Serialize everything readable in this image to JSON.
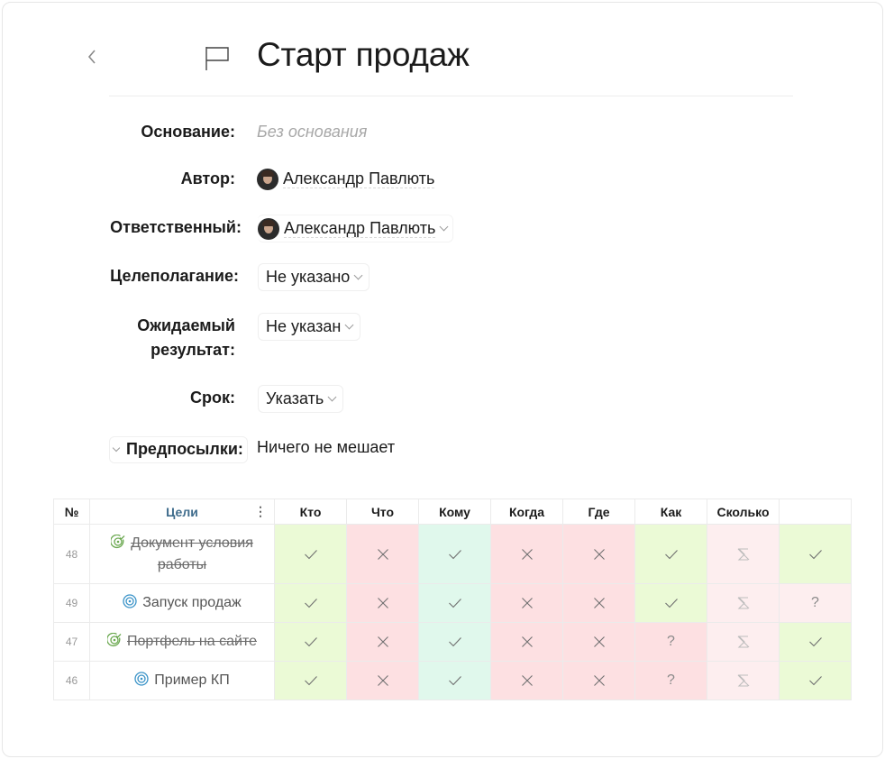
{
  "header": {
    "title": "Старт продаж"
  },
  "fields": {
    "basis": {
      "label": "Основание:",
      "value": "Без основания"
    },
    "author": {
      "label": "Автор:",
      "value": "Александр Павлють"
    },
    "responsible": {
      "label": "Ответственный:",
      "value": "Александр Павлють"
    },
    "goal_setting": {
      "label": "Целеполагание:",
      "value": "Не указано"
    },
    "expected_result": {
      "label_line1": "Ожидаемый",
      "label_line2": "результат:",
      "value": "Не указан"
    },
    "deadline": {
      "label": "Срок:",
      "value": "Указать"
    },
    "prerequisites": {
      "label": "Предпосылки:",
      "value": "Ничего не мешает"
    }
  },
  "table": {
    "headers": {
      "num": "№",
      "goals": "Цели",
      "more": "⋮",
      "questions": [
        "Кто",
        "Что",
        "Кому",
        "Когда",
        "Где",
        "Как",
        "Сколько"
      ]
    },
    "rows": [
      {
        "num": "48",
        "goal": "Документ условия работы",
        "done": true,
        "cells": [
          "check",
          "cross",
          "check",
          "cross",
          "cross",
          "check",
          "sum",
          "check"
        ],
        "colors": [
          "g",
          "r",
          "m",
          "r",
          "r",
          "g",
          "p",
          "g"
        ]
      },
      {
        "num": "49",
        "goal": "Запуск продаж",
        "done": false,
        "cells": [
          "check",
          "cross",
          "check",
          "cross",
          "cross",
          "check",
          "sum",
          "?"
        ],
        "colors": [
          "g",
          "r",
          "m",
          "r",
          "r",
          "g",
          "p",
          "p"
        ]
      },
      {
        "num": "47",
        "goal": "Портфель на сайте",
        "done": true,
        "cells": [
          "check",
          "cross",
          "check",
          "cross",
          "cross",
          "?",
          "sum",
          "check"
        ],
        "colors": [
          "g",
          "r",
          "m",
          "r",
          "r",
          "r",
          "p",
          "g"
        ]
      },
      {
        "num": "46",
        "goal": "Пример КП",
        "done": false,
        "cells": [
          "check",
          "cross",
          "check",
          "cross",
          "cross",
          "?",
          "sum",
          "check"
        ],
        "colors": [
          "g",
          "r",
          "m",
          "r",
          "r",
          "r",
          "p",
          "g"
        ]
      }
    ]
  },
  "colors": {
    "check_green": "#ebfad6",
    "cross_red": "#fde0e2",
    "mint": "#e0f8ec",
    "pale_pink": "#fdeeef",
    "goal_header": "#3f6c8c"
  },
  "icons": {
    "back": "chevron-left-icon",
    "flag": "flag-icon",
    "goal_active": "target-icon",
    "goal_done": "target-check-icon"
  }
}
